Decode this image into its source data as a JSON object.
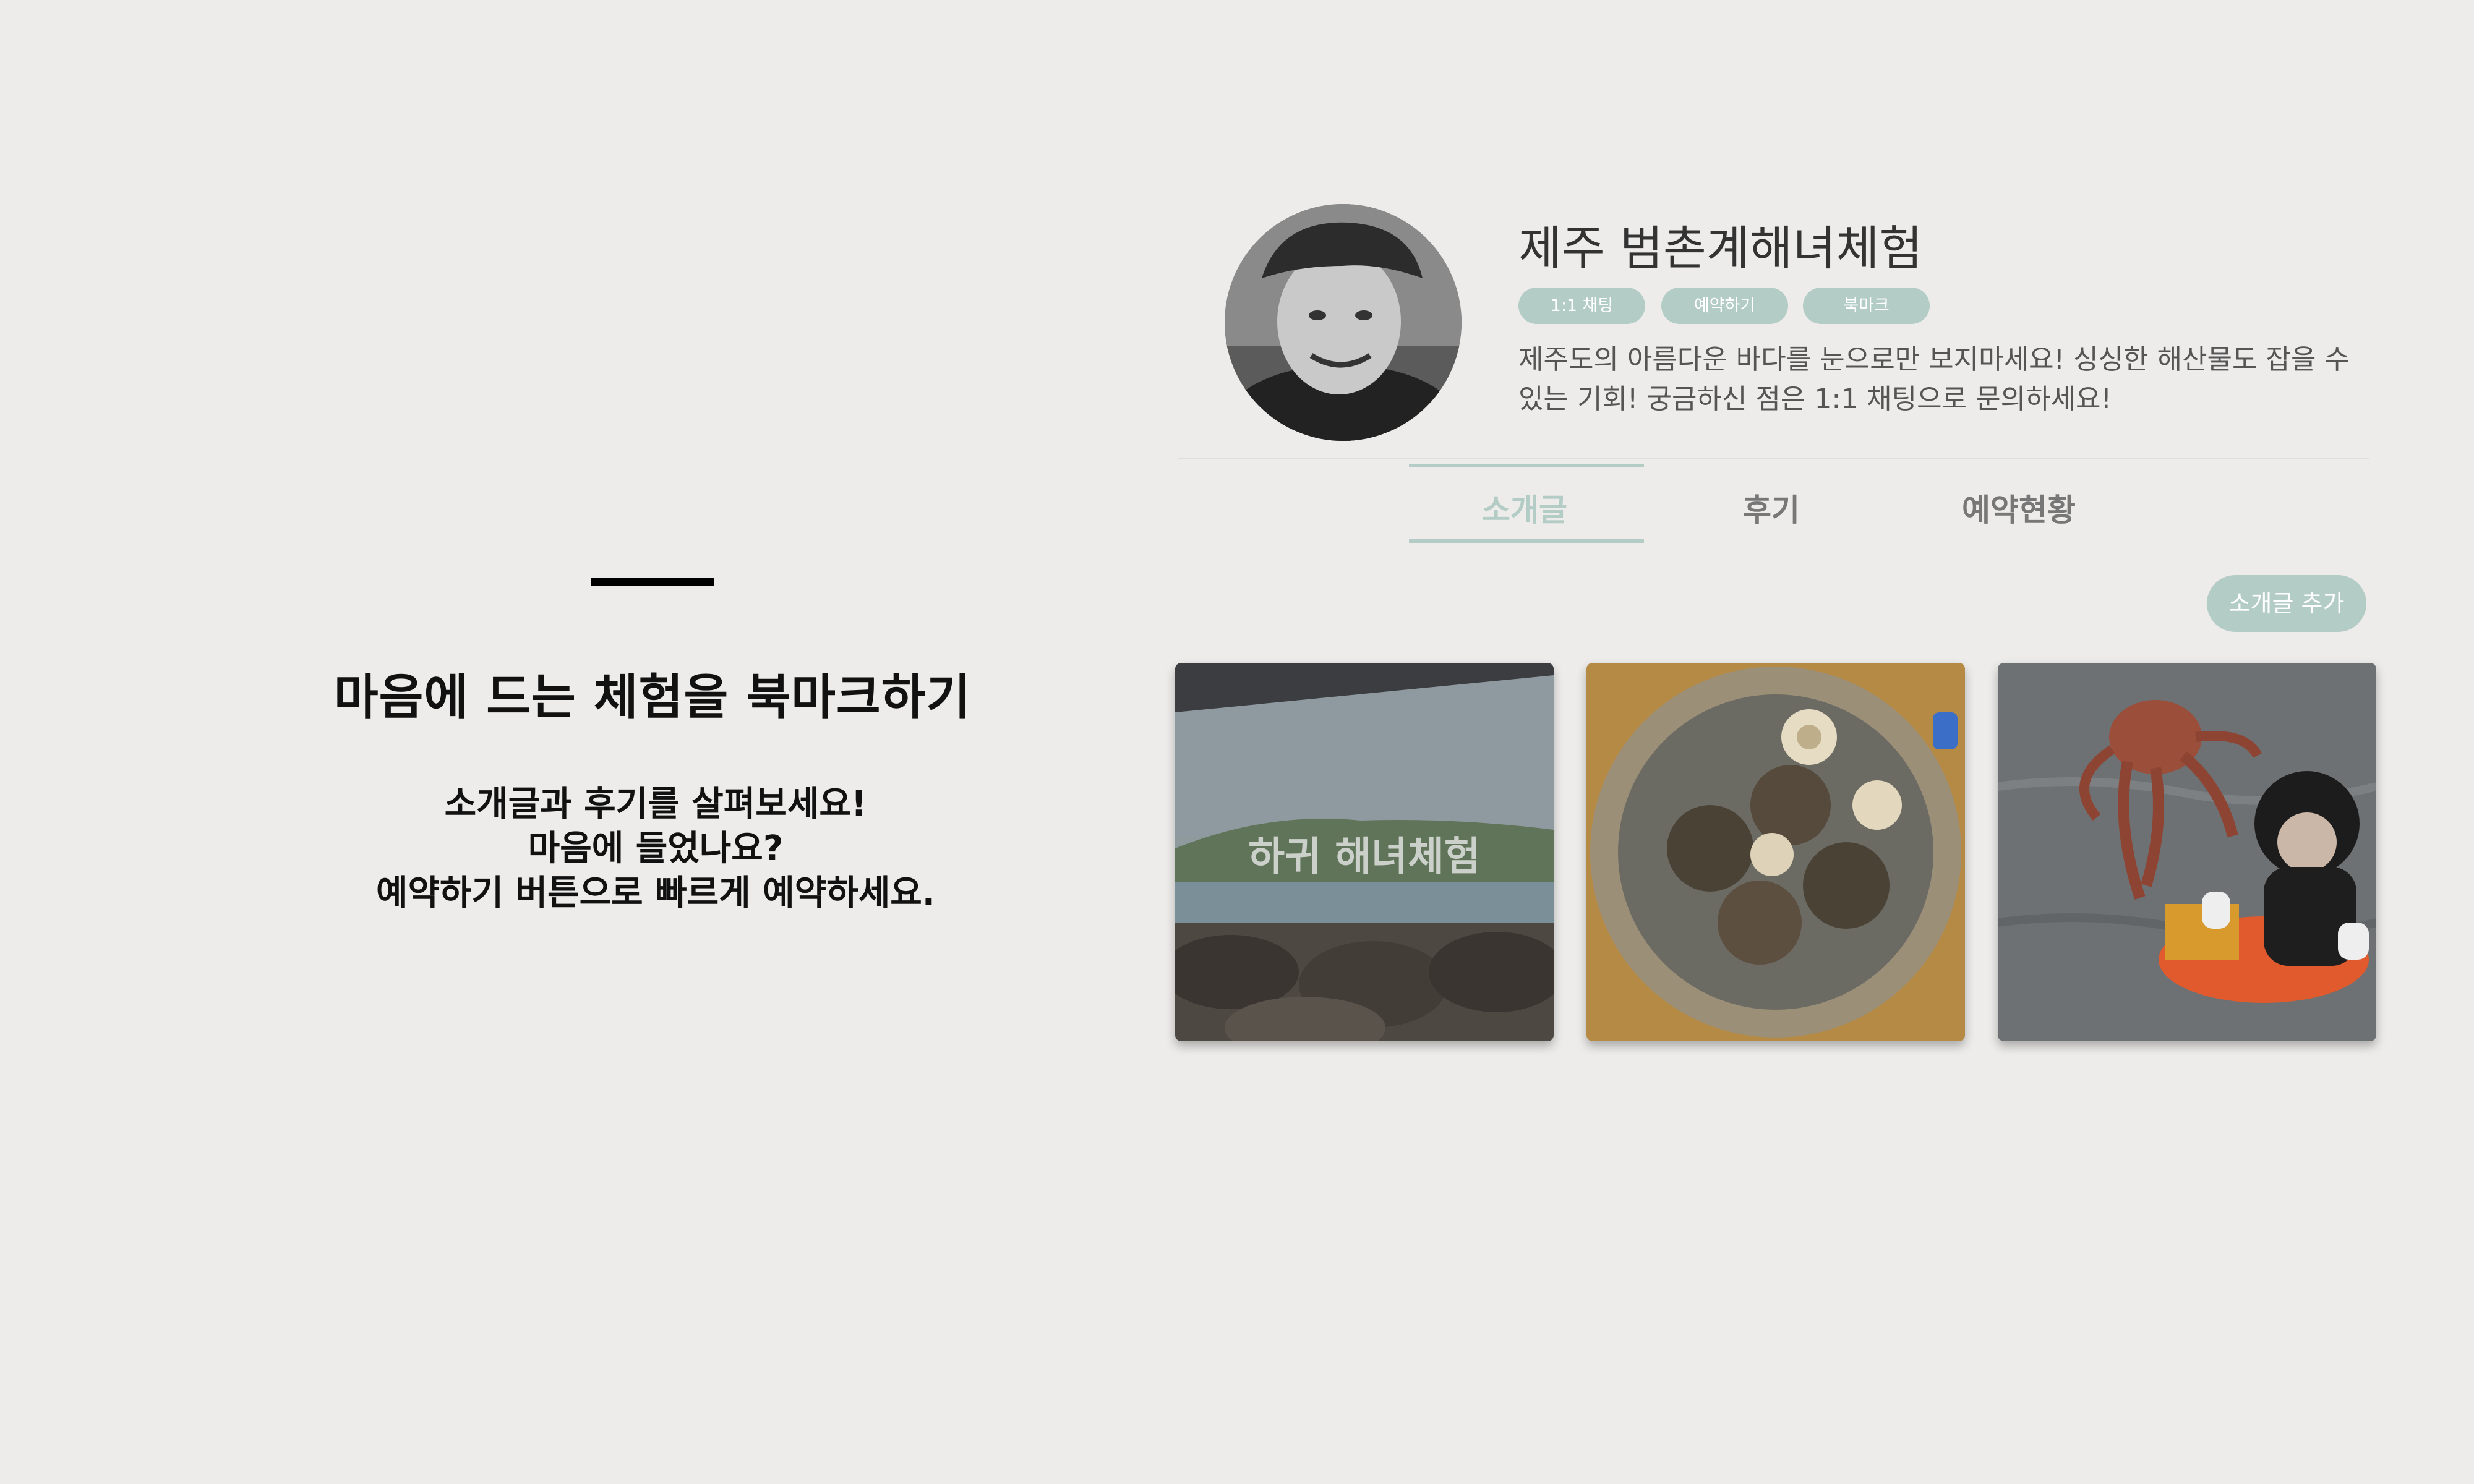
{
  "intro": {
    "title": "마음에 드는 체험을 북마크하기",
    "lines": [
      "소개글과 후기를 살펴보세요!",
      "마음에 들었나요?",
      "예약하기 버튼으로 빠르게 예약하세요."
    ]
  },
  "profile": {
    "name": "제주 범촌계해녀체험",
    "buttons": [
      "1:1 채팅",
      "예약하기",
      "북마크"
    ],
    "description": "제주도의 아름다운 바다를 눈으로만 보지마세요! 싱싱한 해산물도 잡을 수 있는 기회! 궁금하신 점은 1:1 채팅으로 문의하세요!"
  },
  "tabs": [
    {
      "label": "소개글",
      "active": true
    },
    {
      "label": "후기",
      "active": false
    },
    {
      "label": "예약현황",
      "active": false
    }
  ],
  "add_button_label": "소개글 추가",
  "cards": [
    {
      "caption": "하귀 해녀체험",
      "image": "coast-with-rocks"
    },
    {
      "caption": "",
      "image": "bowl-of-turban-shells"
    },
    {
      "caption": "",
      "image": "diver-holding-octopus"
    }
  ],
  "colors": {
    "background": "#edecea",
    "accent": "#b3ccc5",
    "active_tab_text": "#b3ccc5",
    "inactive_tab_text": "#777777"
  }
}
